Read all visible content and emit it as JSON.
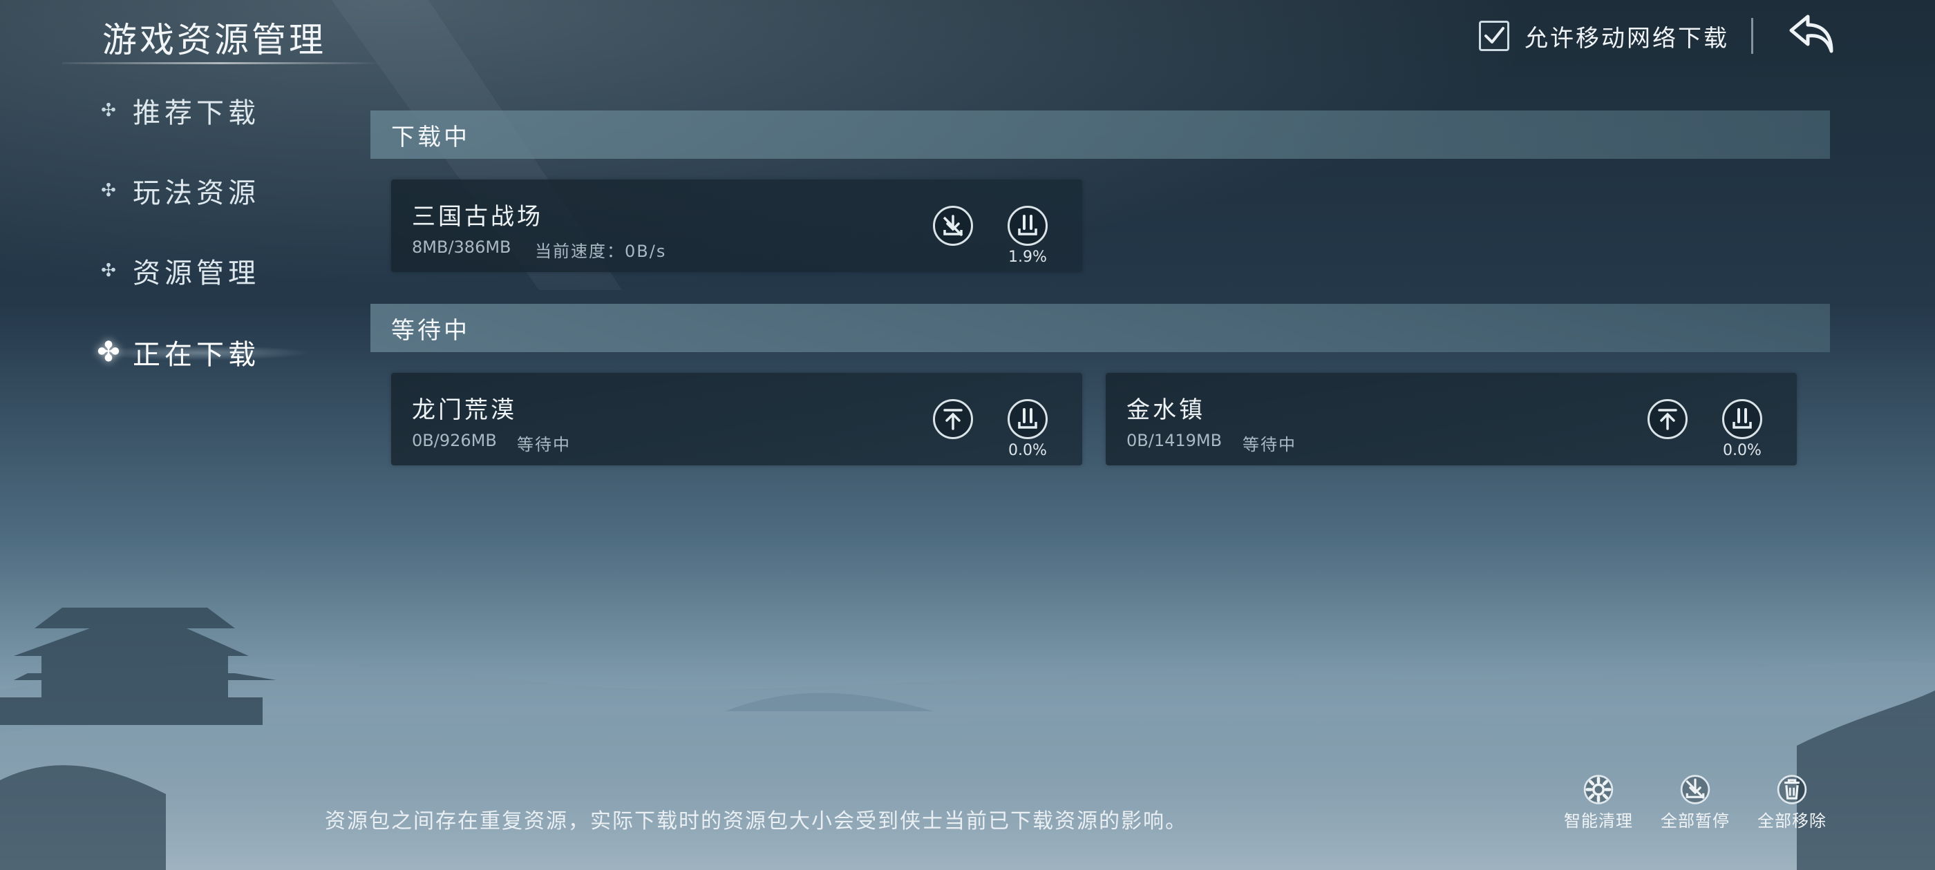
{
  "header": {
    "title": "游戏资源管理",
    "mobile_download_label": "允许移动网络下载",
    "mobile_download_checked": true,
    "back_icon": "back-arrow-icon"
  },
  "sidebar": {
    "items": [
      {
        "label": "推荐下载",
        "active": false
      },
      {
        "label": "玩法资源",
        "active": false
      },
      {
        "label": "资源管理",
        "active": false
      },
      {
        "label": "正在下载",
        "active": true
      }
    ]
  },
  "downloading": {
    "header": "下载中",
    "items": [
      {
        "name": "三国古战场",
        "size": "8MB/386MB",
        "status": "当前速度：0B/s",
        "percent": "1.9%",
        "cancel_icon": "cancel-download-icon",
        "pause_icon": "pause-icon"
      }
    ]
  },
  "waiting": {
    "header": "等待中",
    "items": [
      {
        "name": "龙门荒漠",
        "size": "0B/926MB",
        "status": "等待中",
        "percent": "0.0%",
        "top_icon": "move-to-top-icon",
        "pause_icon": "pause-icon"
      },
      {
        "name": "金水镇",
        "size": "0B/1419MB",
        "status": "等待中",
        "percent": "0.0%",
        "top_icon": "move-to-top-icon",
        "pause_icon": "pause-icon"
      }
    ]
  },
  "footer": {
    "note": "资源包之间存在重复资源，实际下载时的资源包大小会受到侠士当前已下载资源的影响。",
    "buttons": [
      {
        "label": "智能清理",
        "icon": "gear-icon"
      },
      {
        "label": "全部暂停",
        "icon": "pause-all-icon"
      },
      {
        "label": "全部移除",
        "icon": "trash-icon"
      }
    ]
  },
  "colors": {
    "accent": "#d9e3e8",
    "card_bg": "#1a2a36",
    "header_bar": "#6b8797"
  }
}
